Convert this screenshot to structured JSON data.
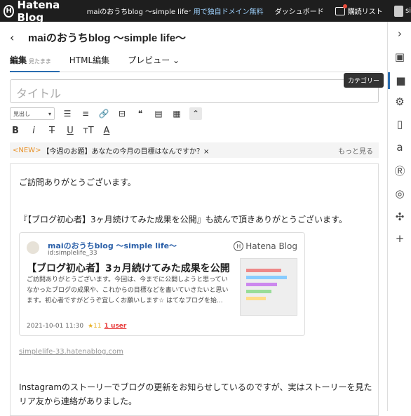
{
  "topbar": {
    "brand": "Hatena Blog",
    "blog_name": "maiのおうちblog 〜simple life〜",
    "domain_promo": "用で独自ドメイン無料",
    "dashboard": "ダッシュボード",
    "subscriptions": "購読リスト",
    "user": "si"
  },
  "editor": {
    "blog_title": "maiのおうちblog 〜simple life〜",
    "tabs": [
      {
        "label": "編集",
        "sub": "見たまま"
      },
      {
        "label": "HTML編集",
        "sub": ""
      },
      {
        "label": "プレビュー ⌄",
        "sub": ""
      }
    ],
    "title_placeholder": "タイトル",
    "heading_select": "見出し",
    "notice_new": "<NEW>",
    "notice_text": "【今週のお題】あなたの今月の目標はなんですか？×",
    "notice_more": "もっと見る",
    "paragraph1": "ご訪問ありがとうございます。",
    "paragraph2": "『【ブログ初心者】3ヶ月続けてみた成果を公開』も読んで頂きありがとうございます。",
    "card": {
      "blog": "maiのおうちblog 〜simple life〜",
      "id": "id:simplelife_33",
      "brand": "Hatena Blog",
      "title": "【ブログ初心者】3ヵ月続けてみた成果を公開",
      "desc": "ご訪問ありがとうございます。今回は、今までに公開しようと思っていなかったブログの成果や、これからの目標などを書いていきたいと思います。初心者ですがどうぞ宜しくお願いします☆ はてなブログを始...",
      "date": "2021-10-01 11:30",
      "stars": "★11",
      "users": "1 user"
    },
    "url": "simplelife-33.hatenablog.com",
    "paragraph3": "Instagramのストーリーでブログの更新をお知らせしているのですが、実はストーリーを見たリア友から連絡がありました。"
  },
  "sidebar": {
    "tooltip": "カテゴリー",
    "icons": [
      "chevron-right-icon",
      "image-icon",
      "folder-icon",
      "gear-icon",
      "document-icon",
      "amazon-icon",
      "rakuten-icon",
      "instagram-icon",
      "slack-icon",
      "plus-icon"
    ]
  }
}
